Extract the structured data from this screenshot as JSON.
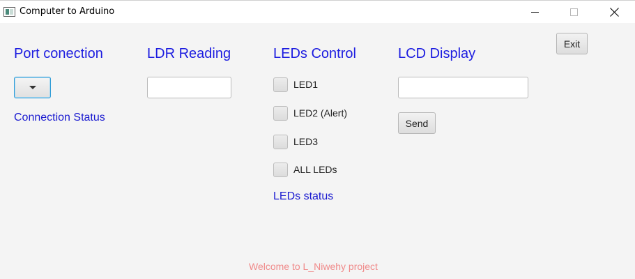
{
  "window": {
    "title": "Computer to Arduino",
    "icon": "app-window-icon",
    "controls": [
      "minimize-icon",
      "maximize-icon",
      "close-icon"
    ]
  },
  "sections": {
    "port": {
      "heading": "Port conection",
      "status": "Connection Status",
      "selected_value": ""
    },
    "ldr": {
      "heading": "LDR Reading",
      "value": ""
    },
    "leds": {
      "heading": "LEDs Control",
      "items": [
        {
          "label": "LED1",
          "checked": false
        },
        {
          "label": "LED2 (Alert)",
          "checked": false
        },
        {
          "label": "LED3",
          "checked": false
        },
        {
          "label": "ALL LEDs",
          "checked": false
        }
      ],
      "status": "LEDs status"
    },
    "lcd": {
      "heading": "LCD Display",
      "value": "",
      "send_label": "Send"
    }
  },
  "exit_label": "Exit",
  "footer": {
    "welcome": "Welcome to L_Niwehy project"
  },
  "colors": {
    "heading": "#1c1ce0",
    "status": "#1a1ad0",
    "welcome": "#f08a8a",
    "combo_focus": "#2e9bd6"
  }
}
